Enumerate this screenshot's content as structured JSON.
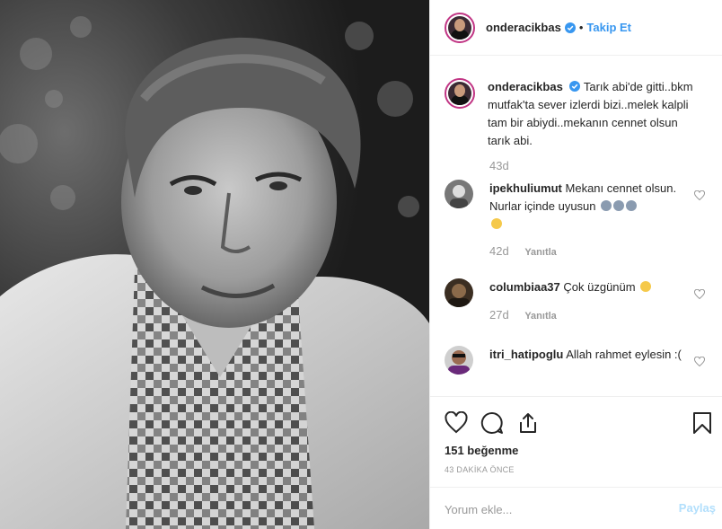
{
  "post": {
    "username": "onderacikbas",
    "follow_label": "Takip Et",
    "separator": "•",
    "caption": "Tarık abi'de gitti..bkm mutfak'ta sever izlerdi bizi..melek kalpli tam bir abiydi..mekanın cennet olsun tarık abi.",
    "caption_time": "43d",
    "likes": "151 beğenme",
    "posted_ago": "43 DAKİKA ÖNCE",
    "icons": [
      "heart-icon",
      "comment-icon",
      "share-icon",
      "bookmark-icon",
      "verified-badge-icon"
    ],
    "accent_color": "#3897f0"
  },
  "comments": [
    {
      "user": "ipekhuliumut",
      "text": "Mekanı cennet olsun. Nurlar içinde uyusun",
      "time": "42d",
      "reply": "Yanıtla"
    },
    {
      "user": "columbiaa37",
      "text": "Çok üzgünüm",
      "time": "27d",
      "reply": "Yanıtla"
    },
    {
      "user": "itri_hatipoglu",
      "text": "Allah rahmet eylesin :(",
      "time": "",
      "reply": ""
    }
  ],
  "composer": {
    "placeholder": "Yorum ekle...",
    "share_label": "Paylaş"
  }
}
